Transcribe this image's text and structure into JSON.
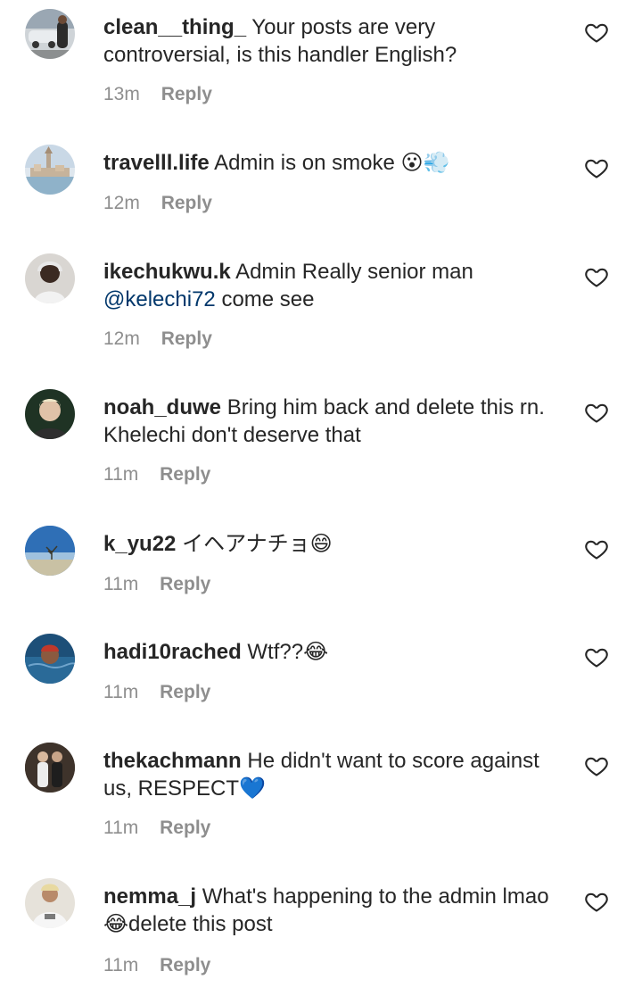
{
  "comments": [
    {
      "username": "clean__thing_",
      "text": "Your posts are very controversial, is this handler English?",
      "mention": "",
      "after": "",
      "emoji": "",
      "time": "13m",
      "reply": "Reply",
      "avatar_icon": "car-photo-avatar"
    },
    {
      "username": "travelll.life",
      "text": "Admin is on smoke",
      "mention": "",
      "after": "",
      "emoji": "😮💨",
      "time": "12m",
      "reply": "Reply",
      "avatar_icon": "coastal-town-avatar"
    },
    {
      "username": "ikechukwu.k",
      "text": "Admin Really senior man",
      "mention": "@kelechi72",
      "after": "come see",
      "emoji": "",
      "time": "12m",
      "reply": "Reply",
      "avatar_icon": "person-hoodie-avatar"
    },
    {
      "username": "noah_duwe",
      "text": "Bring him back and delete this rn. Khelechi don't deserve that",
      "mention": "",
      "after": "",
      "emoji": "",
      "time": "11m",
      "reply": "Reply",
      "avatar_icon": "person-portrait-avatar"
    },
    {
      "username": "k_yu22",
      "text": "イヘアナチョ",
      "mention": "",
      "after": "",
      "emoji": "😄",
      "time": "11m",
      "reply": "Reply",
      "avatar_icon": "tree-sky-avatar"
    },
    {
      "username": "hadi10rached",
      "text": "Wtf??",
      "mention": "",
      "after": "",
      "emoji": "😂",
      "time": "11m",
      "reply": "Reply",
      "avatar_icon": "swimmer-avatar"
    },
    {
      "username": "thekachmann",
      "text": "He didn't want to score against us, RESPECT",
      "mention": "",
      "after": "",
      "emoji": "💙",
      "time": "11m",
      "reply": "Reply",
      "avatar_icon": "couple-photo-avatar"
    },
    {
      "username": "nemma_j",
      "text": "What's happening to the admin lmao",
      "mention": "",
      "after": "delete this post",
      "emoji": "😂",
      "time": "11m",
      "reply": "Reply",
      "avatar_icon": "person-shirt-avatar"
    }
  ],
  "icons": {
    "like": "heart-outline-icon"
  },
  "colors": {
    "text": "#262626",
    "meta": "#8e8e8e",
    "mention": "#00376b"
  }
}
